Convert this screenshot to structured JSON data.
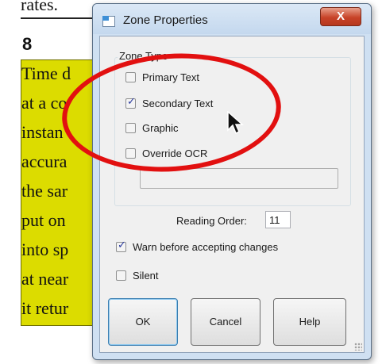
{
  "document": {
    "top_text": "rates.",
    "heading_number": "8",
    "lines": [
      "Time d",
      "at a co",
      "instan",
      "accura",
      "the sar",
      "put on",
      "into sp",
      "at near",
      "it retur"
    ],
    "highlight_color": "#dcdc00"
  },
  "dialog": {
    "title": "Zone Properties",
    "close_label": "X",
    "zone_type": {
      "label": "Zone Type",
      "options": [
        {
          "label": "Primary Text",
          "checked": false
        },
        {
          "label": "Secondary Text",
          "checked": true
        },
        {
          "label": "Graphic",
          "checked": false
        },
        {
          "label": "Override OCR",
          "checked": false
        }
      ],
      "ocr_text_value": ""
    },
    "reading_order": {
      "label": "Reading Order:",
      "value": "11"
    },
    "warn_changes": {
      "label": "Warn before accepting changes",
      "checked": true
    },
    "silent": {
      "label": "Silent",
      "checked": false
    },
    "buttons": {
      "ok": "OK",
      "cancel": "Cancel",
      "help": "Help"
    }
  },
  "colors": {
    "annotation": "#e21010",
    "title_bar": "#cfe0f2",
    "close_button": "#c84328"
  },
  "icons": {
    "app": "zone-properties-icon",
    "cursor": "mouse-pointer-icon"
  }
}
